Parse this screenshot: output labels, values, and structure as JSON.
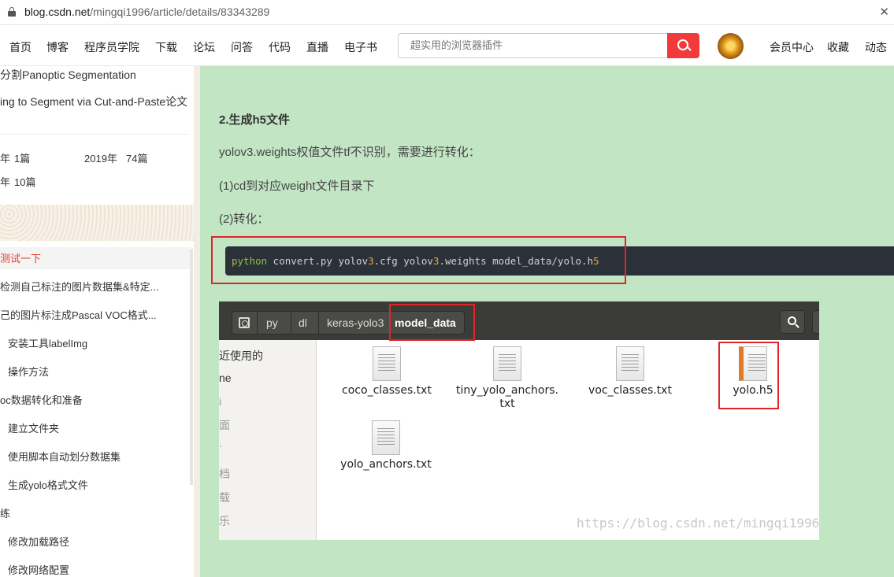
{
  "browser": {
    "url_host": "blog.csdn.net",
    "url_path": "/mingqi1996/article/details/83343289"
  },
  "nav": {
    "items": [
      "首页",
      "博客",
      "程序员学院",
      "下载",
      "论坛",
      "问答",
      "代码",
      "直播",
      "电子书"
    ],
    "search_placeholder": "超实用的浏览器插件",
    "right_items": [
      "会员中心",
      "收藏",
      "动态"
    ]
  },
  "sidebar": {
    "related": [
      "分割Panoptic Segmentation",
      "ing to Segment via Cut-and-Paste论文"
    ],
    "archive": [
      {
        "year": "年",
        "count": "1篇"
      },
      {
        "year": "2019年",
        "count": "74篇"
      },
      {
        "year": "年",
        "count": "10篇"
      }
    ],
    "toc": [
      "测试一下",
      "检测自己标注的图片数据集&特定...",
      "己的图片标注成Pascal VOC格式...",
      "安装工具labelImg",
      "操作方法",
      "oc数据转化和准备",
      "建立文件夹",
      "使用脚本自动划分数据集",
      "生成yolo格式文件",
      "练",
      "修改加载路径",
      "修改网络配置"
    ]
  },
  "article": {
    "heading": "2.生成h5文件",
    "p1": "yolov3.weights权值文件tf不识别，需要进行转化：",
    "p2": "(1)cd到对应weight文件目录下",
    "p3": "(2)转化：",
    "code": {
      "kw": "python",
      "t1": " convert.py yolov",
      "n1": "3",
      "t2": ".cfg yolov",
      "n2": "3",
      "t3": ".weights model_data/yolo.h",
      "n3": "5"
    }
  },
  "file_manager": {
    "crumbs": [
      "py",
      "dl",
      "keras-yolo3",
      "model_data"
    ],
    "sidebar": [
      "近使用的",
      "ne",
      "i",
      "面",
      "·",
      "档",
      "载",
      "乐"
    ],
    "files": [
      "coco_classes.txt",
      "tiny_yolo_anchors.\ntxt",
      "voc_classes.txt",
      "yolo.h5",
      "yolo_anchors.txt"
    ],
    "watermark": "https://blog.csdn.net/mingqi1996"
  }
}
